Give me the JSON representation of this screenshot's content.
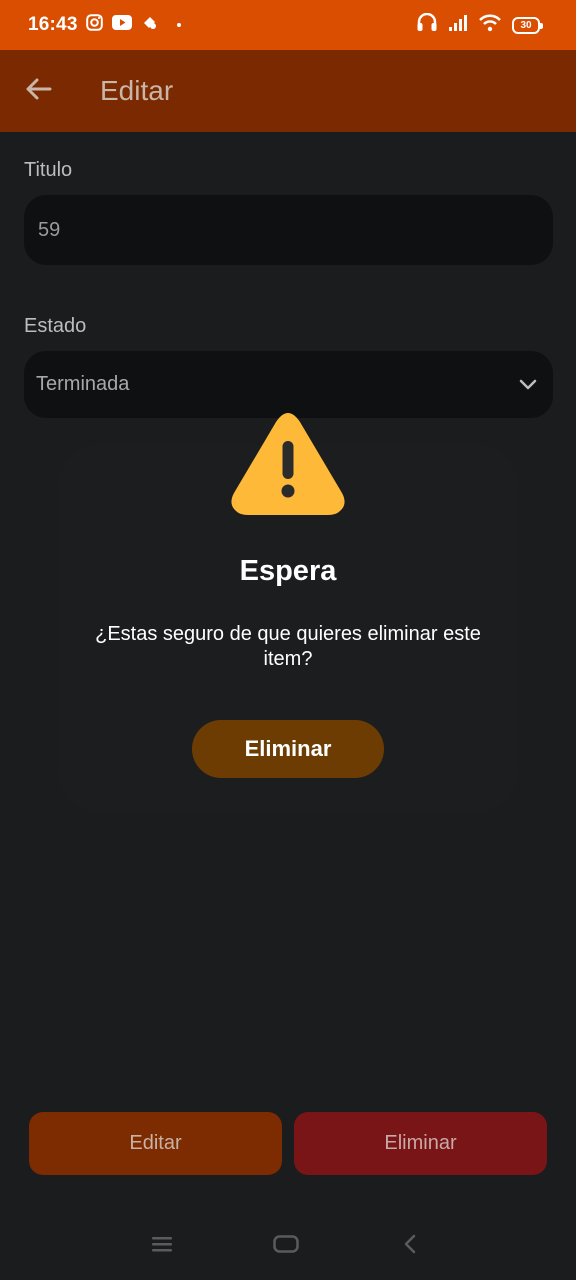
{
  "status_bar": {
    "time": "16:43",
    "battery": "30",
    "icons": [
      "instagram-icon",
      "youtube-icon",
      "maps-icon",
      "headset-icon",
      "signal-icon",
      "wifi-icon",
      "battery-icon"
    ]
  },
  "app_bar": {
    "title": "Editar",
    "back_icon": "arrow-left-icon"
  },
  "form": {
    "titulo_label": "Titulo",
    "titulo_value": "59",
    "estado_label": "Estado",
    "estado_value": "Terminada"
  },
  "dialog": {
    "icon": "warning-icon",
    "title": "Espera",
    "message": "¿Estas seguro de que quieres eliminar este item?",
    "button_label": "Eliminar"
  },
  "actions": {
    "edit_label": "Editar",
    "delete_label": "Eliminar"
  },
  "nav_bar": {
    "icons": [
      "menu-icon",
      "home-icon",
      "back-icon"
    ]
  },
  "colors": {
    "status_bar": "#d94e00",
    "app_bar": "#7a2900",
    "background": "#1a1c1e",
    "warning": "#ffb938",
    "dialog_button": "#6d3c03",
    "edit_button": "#7d2b00",
    "delete_button": "#7a1517"
  }
}
